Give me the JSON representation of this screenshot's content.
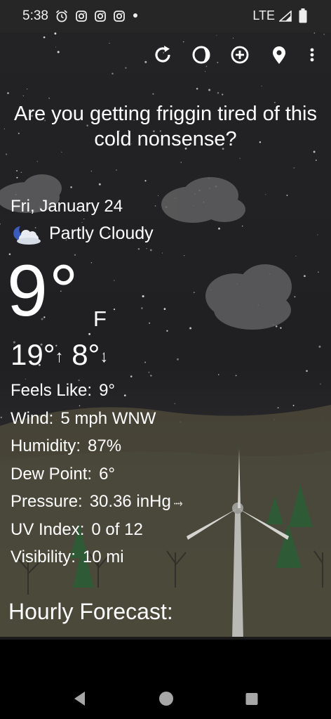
{
  "status_bar": {
    "time": "5:38",
    "network": "LTE",
    "icons": [
      "alarm-icon",
      "instagram-icon",
      "instagram-icon",
      "instagram-icon",
      "notification-dot"
    ]
  },
  "toolbar": {
    "buttons": [
      "refresh-icon",
      "theme-icon",
      "add-location-icon",
      "location-pin-icon",
      "overflow-menu-icon"
    ]
  },
  "headline": "Are you getting friggin tired of this cold nonsense?",
  "current": {
    "date": "Fri, January 24",
    "condition": "Partly Cloudy",
    "condition_icon": "partly-cloudy-night-icon",
    "temp": "9°",
    "unit": "F",
    "high": "19°",
    "low": "8°",
    "high_arrow": "↑",
    "low_arrow": "↓"
  },
  "details": [
    {
      "label": "Feels Like:",
      "value": "9°"
    },
    {
      "label": "Wind:",
      "value": "5 mph WNW"
    },
    {
      "label": "Humidity:",
      "value": "87%"
    },
    {
      "label": "Dew Point:",
      "value": "6°"
    },
    {
      "label": "Pressure:",
      "value": "30.36 inHg",
      "trend": "⤑"
    },
    {
      "label": "UV Index:",
      "value": "0 of 12"
    },
    {
      "label": "Visibility:",
      "value": "10 mi"
    }
  ],
  "hourly_title": "Hourly Forecast:",
  "colors": {
    "status_bar_bg": "#262626",
    "sky": "#232325",
    "text": "#ffffff",
    "cloud": "#5e5e60"
  }
}
